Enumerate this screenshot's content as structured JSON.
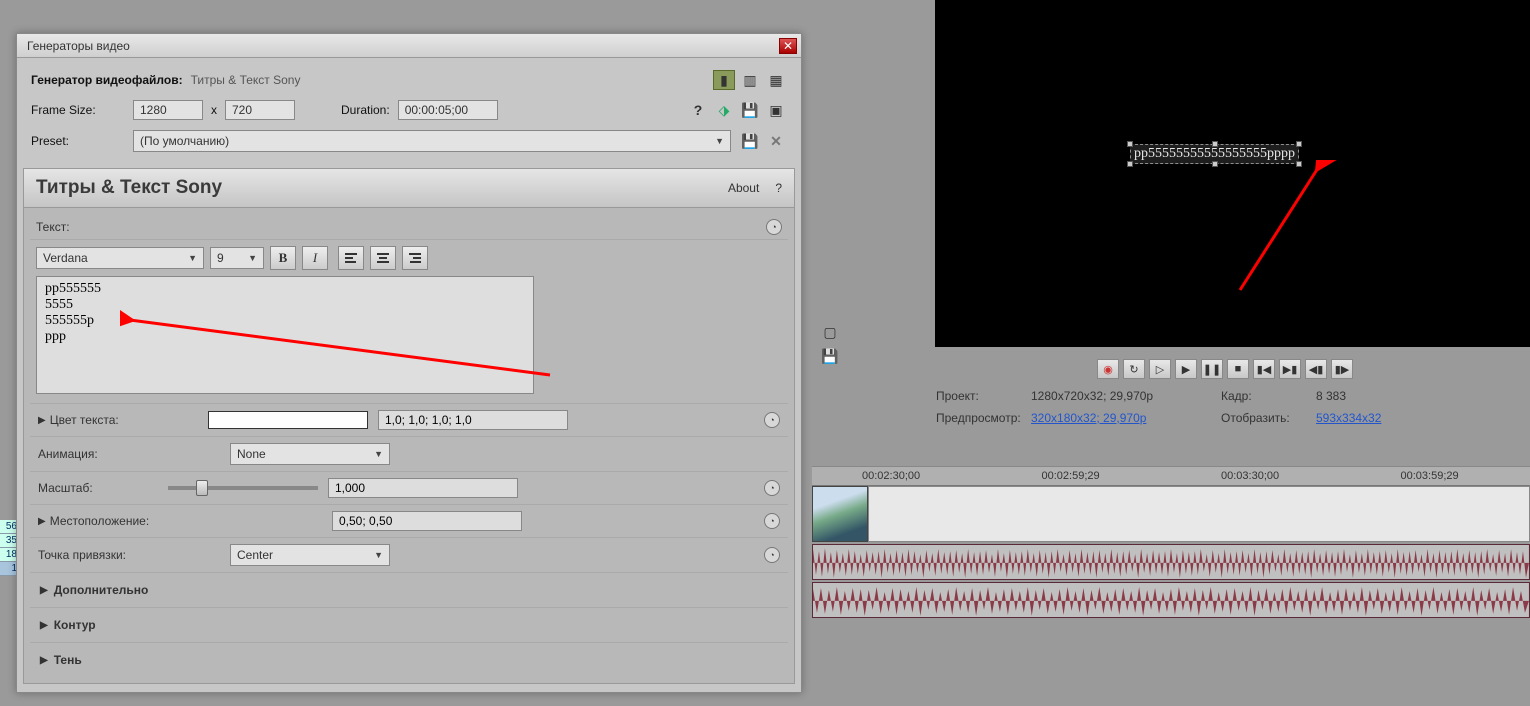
{
  "dialog": {
    "title": "Генераторы видео",
    "generator_label": "Генератор видеофайлов:",
    "generator_name": "Титры & Текст Sony",
    "frame_size_label": "Frame Size:",
    "frame_w": "1280",
    "frame_x": "x",
    "frame_h": "720",
    "duration_label": "Duration:",
    "duration_value": "00:00:05;00",
    "preset_label": "Preset:",
    "preset_value": "(По умолчанию)"
  },
  "panel": {
    "title": "Титры & Текст Sony",
    "about": "About",
    "help": "?",
    "text_label": "Текст:",
    "font_name": "Verdana",
    "font_size": "9",
    "text_value": "pp555555\n5555\n555555p\nppp",
    "text_color_label": "Цвет текста:",
    "text_color_value": "1,0; 1,0; 1,0; 1,0",
    "animation_label": "Анимация:",
    "animation_value": "None",
    "scale_label": "Масштаб:",
    "scale_value": "1,000",
    "location_label": "Местоположение:",
    "location_value": "0,50; 0,50",
    "anchor_label": "Точка привязки:",
    "anchor_value": "Center",
    "additional": "Дополнительно",
    "outline": "Контур",
    "shadow": "Тень"
  },
  "preview": {
    "video_text": "pp55555555555555555pppp",
    "project_label": "Проект:",
    "project_value": "1280x720x32; 29,970p",
    "frame_label": "Кадр:",
    "frame_value": "8 383",
    "preview_label": "Предпросмотр:",
    "preview_value": "320x180x32; 29,970p",
    "display_label": "Отобразить:",
    "display_value": "593x334x32"
  },
  "timeline": {
    "ticks": [
      "00:02:30;00",
      "00:02:59;29",
      "00:03:30;00",
      "00:03:59;29"
    ]
  },
  "leftfrag": {
    "a": "56",
    "b": "35",
    "c": "18",
    "d": "1"
  }
}
